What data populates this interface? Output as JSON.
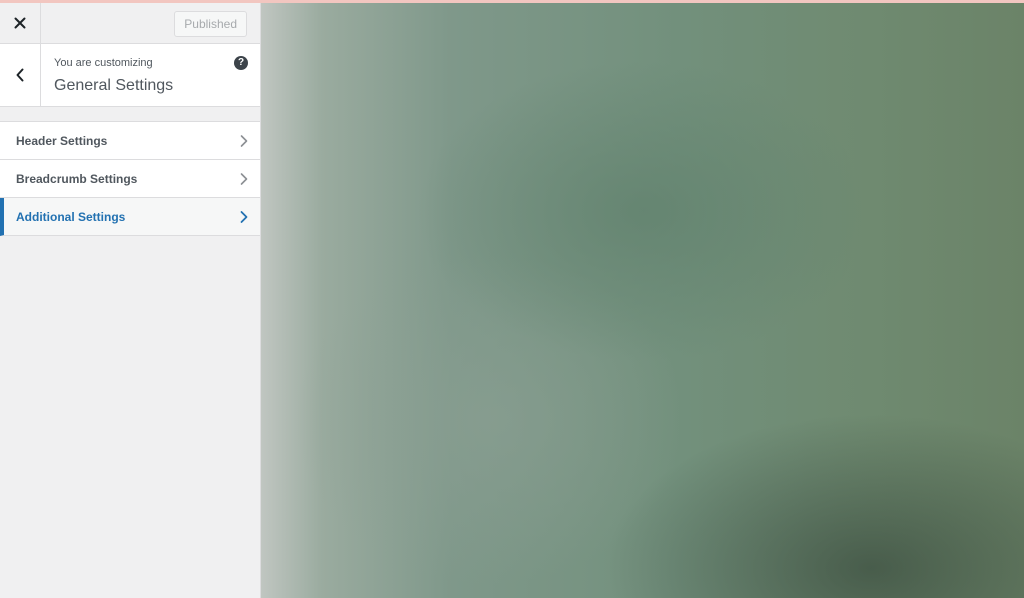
{
  "header": {
    "publish_label": "Published"
  },
  "panel": {
    "customizing_label": "You are customizing",
    "section_title": "General Settings",
    "help_glyph": "?"
  },
  "menu": {
    "items": [
      {
        "label": "Header Settings"
      },
      {
        "label": "Breadcrumb Settings"
      },
      {
        "label": "Additional Settings"
      }
    ]
  },
  "colors": {
    "accent": "#2271b1",
    "text": "#50575e",
    "border": "#dcdcde"
  },
  "icons": {
    "close": "close-icon",
    "back": "chevron-left-icon",
    "help": "question-circle-icon",
    "menu_item": "chevron-right-icon"
  }
}
